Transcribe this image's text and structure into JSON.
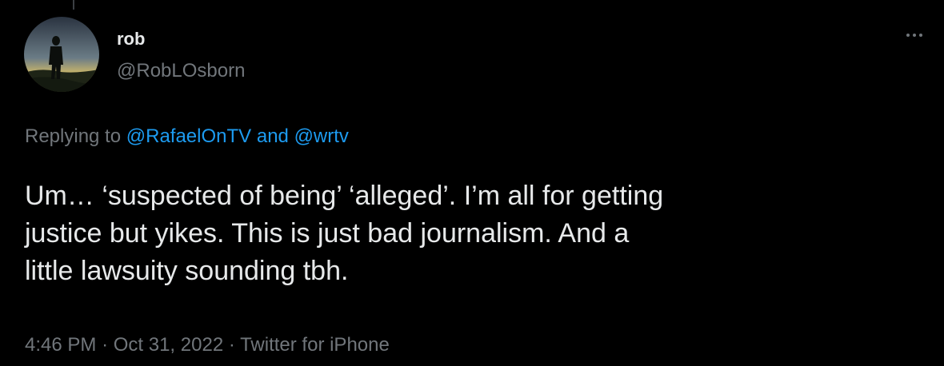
{
  "user": {
    "display_name": "rob",
    "handle": "@RobLOsborn"
  },
  "reply_context": {
    "prefix": "Replying to",
    "mention_1": "@RafaelOnTV",
    "conjunction": "and",
    "mention_2": "@wrtv"
  },
  "tweet": {
    "text_lines": [
      "Um… ‘suspected of being’ ‘alleged’. I’m all for getting",
      "justice but yikes. This is just bad journalism. And a",
      "little lawsuity sounding tbh."
    ]
  },
  "meta": {
    "time": "4:46 PM",
    "separator": "·",
    "date": "Oct 31, 2022",
    "source": "Twitter for iPhone"
  },
  "icons": {
    "more": "more-horizontal-icon"
  },
  "colors": {
    "background": "#000000",
    "primary_text": "#e7e9ea",
    "secondary_text": "#71767b",
    "link": "#1d9bf0"
  }
}
